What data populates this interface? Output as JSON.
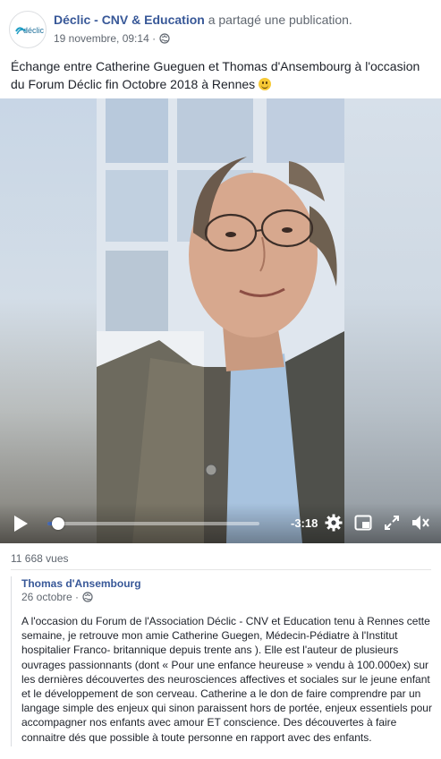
{
  "header": {
    "page_name": "Déclic - CNV & Education",
    "shared_text": "a partagé une publication.",
    "timestamp": "19 novembre, 09:14 ·",
    "avatar_logo_text": "déclic",
    "privacy_icon": "globe-icon"
  },
  "post": {
    "text": "Échange entre Catherine Gueguen et Thomas d'Ansembourg à l'occasion du Forum Déclic fin Octobre 2018 à Rennes",
    "emoji": "slightly-smiling-face"
  },
  "video": {
    "time_remaining": "-3:18",
    "progress": 0.05,
    "icons": [
      "play-icon",
      "settings-gear-icon",
      "picture-in-picture-icon",
      "fullscreen-icon",
      "volume-muted-icon"
    ]
  },
  "stats": {
    "views": "11 668 vues"
  },
  "original_post": {
    "author": "Thomas d'Ansembourg",
    "date": "26 octobre ·",
    "text": "A l'occasion du Forum de l'Association Déclic - CNV et Education tenu à Rennes cette semaine, je retrouve mon amie Catherine Guegen, Médecin-Pédiatre à l'Institut hospitalier Franco- britannique depuis trente ans ). Elle est l'auteur de plusieurs ouvrages passionnants (dont « Pour une enfance heureuse » vendu à 100.000ex) sur les dernières découvertes des neurosciences affectives et sociales sur le jeune enfant et le développement de son cerveau. Catherine a le don de faire comprendre par un langage simple des enjeux qui sinon paraissent hors de portée, enjeux essentiels pour accompagner nos enfants avec amour ET conscience. Des découvertes à faire connaitre dés que possible à toute personne en rapport avec des enfants."
  },
  "colors": {
    "link": "#385898",
    "meta": "#606770",
    "text": "#1d2129",
    "progress": "#4267b2"
  }
}
